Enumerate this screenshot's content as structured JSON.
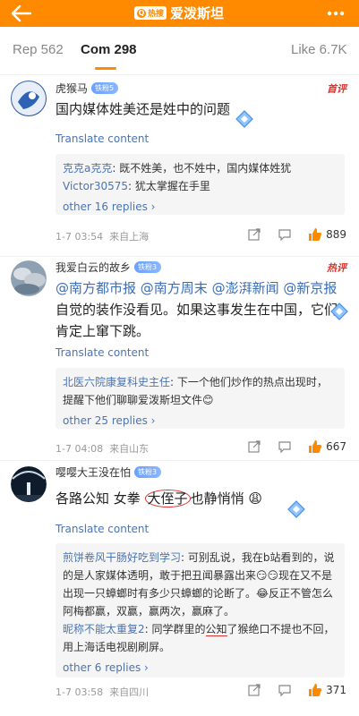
{
  "header": {
    "hot_label": "热搜",
    "title": "爱泼斯坦"
  },
  "tabs": [
    {
      "label": "Rep 562"
    },
    {
      "label": "Com 298"
    },
    {
      "label": "Like 6.7K"
    }
  ],
  "comments": [
    {
      "user": "虎猴马",
      "fan_badge": "铁粉5",
      "corner_tag": "首评",
      "text": "国内媒体姓美还是姓中的问题",
      "translate": "Translate content",
      "replies": [
        {
          "name": "克克a克克",
          "text": ": 既不姓美，也不姓中，国内媒体姓犹"
        },
        {
          "name": "Victor30575",
          "text": ": 犹太掌握在手里"
        }
      ],
      "more_replies": "other 16 replies",
      "time": "1-7 03:54",
      "location": "来自上海",
      "likes": "889"
    },
    {
      "user": "我爱白云的故乡",
      "fan_badge": "铁粉3",
      "corner_tag": "热评",
      "mentions": [
        "@南方都市报",
        "@南方周末",
        "@澎湃新闻",
        "@新京报"
      ],
      "text": "自觉的装作没看见。如果这事发生在中国，它们肯定上窜下跳。",
      "translate": "Translate content",
      "replies": [
        {
          "name": "北医六院康复科史主任",
          "text": ": 下一个他们炒作的热点出现时，提醒下他们聊聊爱泼斯坦文件😊"
        }
      ],
      "more_replies": "other 25 replies",
      "time": "1-7 04:08",
      "location": "来自山东",
      "likes": "667"
    },
    {
      "user": "嘤嘤大王没在怕",
      "fan_badge": "铁粉3",
      "text_pre": "各路公知  女拳  ",
      "text_circled": "大侄子",
      "text_post": "也静悄悄 😩",
      "translate": "Translate content",
      "replies": [
        {
          "name": "煎饼卷风干肠好吃到学习",
          "text": ": 可别乱说，我在b站看到的，说的是人家媒体透明，敢于把丑闻暴露出来😏😏现在又不是出现一只蟑螂时有多少只蟑螂的论断了。😂反正不管怎么阿梅都赢，双赢，赢两次，赢麻了。"
        },
        {
          "name": "昵称不能太重复2",
          "text_pre": ": 同学群里的",
          "text_underlined": "公知",
          "text_post": "了猴绝口不提也不回，用上海话电视剧刷屏。"
        }
      ],
      "more_replies": "other 6 replies",
      "time": "1-7 03:58",
      "location": "来自四川",
      "likes": "371"
    }
  ],
  "colors": {
    "accent": "#ff8a00",
    "link": "#4a74b4",
    "fan_badge": "#6aa0ff",
    "hot_red": "#e0312b"
  }
}
